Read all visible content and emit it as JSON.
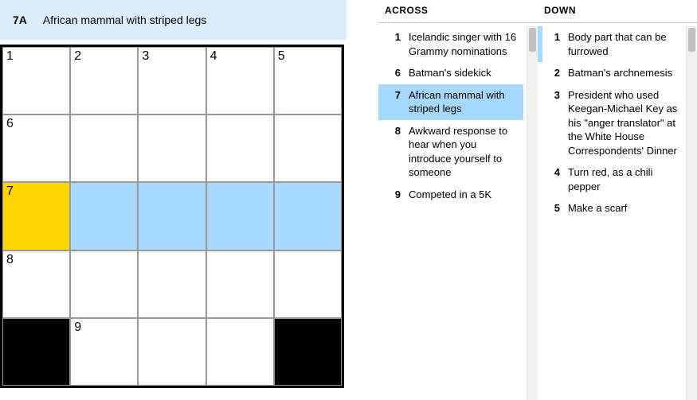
{
  "current_clue": {
    "label": "7A",
    "text": "African mammal with striped legs"
  },
  "grid": {
    "size": 5,
    "cells": [
      {
        "r": 0,
        "c": 0,
        "num": "1"
      },
      {
        "r": 0,
        "c": 1,
        "num": "2"
      },
      {
        "r": 0,
        "c": 2,
        "num": "3"
      },
      {
        "r": 0,
        "c": 3,
        "num": "4"
      },
      {
        "r": 0,
        "c": 4,
        "num": "5"
      },
      {
        "r": 1,
        "c": 0,
        "num": "6"
      },
      {
        "r": 1,
        "c": 1
      },
      {
        "r": 1,
        "c": 2
      },
      {
        "r": 1,
        "c": 3
      },
      {
        "r": 1,
        "c": 4
      },
      {
        "r": 2,
        "c": 0,
        "num": "7",
        "state": "focus"
      },
      {
        "r": 2,
        "c": 1,
        "state": "hl"
      },
      {
        "r": 2,
        "c": 2,
        "state": "hl"
      },
      {
        "r": 2,
        "c": 3,
        "state": "hl"
      },
      {
        "r": 2,
        "c": 4,
        "state": "hl"
      },
      {
        "r": 3,
        "c": 0,
        "num": "8"
      },
      {
        "r": 3,
        "c": 1
      },
      {
        "r": 3,
        "c": 2
      },
      {
        "r": 3,
        "c": 3
      },
      {
        "r": 3,
        "c": 4
      },
      {
        "r": 4,
        "c": 0,
        "state": "black"
      },
      {
        "r": 4,
        "c": 1,
        "num": "9"
      },
      {
        "r": 4,
        "c": 2
      },
      {
        "r": 4,
        "c": 3
      },
      {
        "r": 4,
        "c": 4,
        "state": "black"
      }
    ]
  },
  "across": {
    "title": "ACROSS",
    "clues": [
      {
        "num": "1",
        "text": "Icelandic singer with 16 Grammy nominations"
      },
      {
        "num": "6",
        "text": "Batman's sidekick"
      },
      {
        "num": "7",
        "text": "African mammal with striped legs",
        "selected": true
      },
      {
        "num": "8",
        "text": "Awkward response to hear when you introduce yourself to someone"
      },
      {
        "num": "9",
        "text": "Competed in a 5K"
      }
    ]
  },
  "down": {
    "title": "DOWN",
    "clues": [
      {
        "num": "1",
        "text": "Body part that can be furrowed",
        "related": true
      },
      {
        "num": "2",
        "text": "Batman's archnemesis"
      },
      {
        "num": "3",
        "text": "President who used Keegan-Michael Key as his \"anger translator\" at the White House Correspondents' Dinner"
      },
      {
        "num": "4",
        "text": "Turn red, as a chili pepper"
      },
      {
        "num": "5",
        "text": "Make a scarf"
      }
    ]
  }
}
